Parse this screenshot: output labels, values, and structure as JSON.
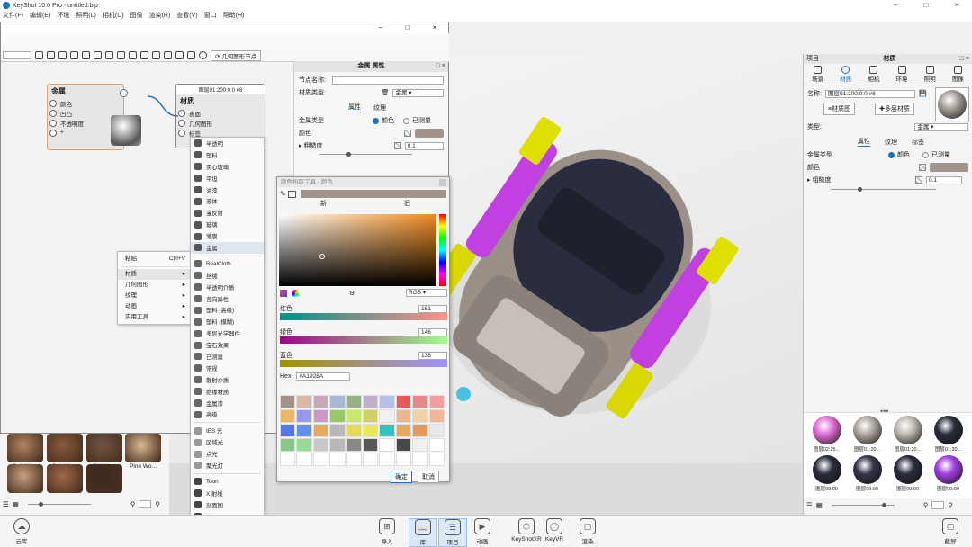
{
  "app": {
    "title": "KeyShot 10.0 Pro  -  untitled.bip"
  },
  "menu": [
    "文件(F)",
    "编辑(E)",
    "环境",
    "照明(L)",
    "相机(C)",
    "图像",
    "渲染(R)",
    "查看(V)",
    "窗口",
    "帮助(H)"
  ],
  "node_editor": {
    "geometry_node_button": "几何图形节点",
    "metal_node": {
      "title": "金属",
      "ports": [
        "颜色",
        "凹凸",
        "不透明度",
        "+"
      ]
    },
    "material_node": {
      "header": "图层01:200:0:0 #8",
      "title": "材质",
      "ports": [
        "表面",
        "几何图形",
        "标签"
      ]
    }
  },
  "properties": {
    "title": "金属 属性",
    "node_name_label": "节点名称:",
    "material_type_label": "材质类型:",
    "material_type_value": "金属",
    "tabs": [
      "属性",
      "纹理"
    ],
    "metal_type_label": "金属类型",
    "radio_color": "颜色",
    "radio_measured": "已测量",
    "color_label": "颜色",
    "roughness_label": "粗糙度",
    "roughness_value": "0.1"
  },
  "context_menu": {
    "items": [
      {
        "label": "粘贴",
        "shortcut": "Ctrl+V"
      },
      {
        "label": "材质",
        "arrow": "▸"
      },
      {
        "label": "几何图形",
        "arrow": "▸"
      },
      {
        "label": "纹理",
        "arrow": "▸"
      },
      {
        "label": "动画",
        "arrow": "▸"
      },
      {
        "label": "实用工具",
        "arrow": "▸"
      }
    ]
  },
  "submenu": {
    "group1": [
      "半透明",
      "塑料",
      "实心玻璃",
      "平坦",
      "油漆",
      "液体",
      "漫反射",
      "玻璃",
      "薄膜",
      "金属"
    ],
    "group2": [
      "RealCloth",
      "丝绒",
      "半透明介质",
      "各向异性",
      "塑料 (高级)",
      "塑料 (模糊)",
      "多层光学器件",
      "宝石效果",
      "已测量",
      "常规",
      "散射介质",
      "绝缘材质",
      "金属漆",
      "高级"
    ],
    "group3": [
      "IES 光",
      "区域光",
      "点光",
      "聚光灯"
    ],
    "group4": [
      "Toon",
      "X 射线",
      "剖面图",
      "地面",
      "线框",
      "自发光"
    ]
  },
  "color_picker": {
    "title": "颜色拾取工具 - 颜色",
    "new_label": "新",
    "old_label": "旧",
    "mode": "RGB",
    "red_label": "红色",
    "red_value": "161",
    "green_label": "绿色",
    "green_value": "146",
    "blue_label": "蓝色",
    "blue_value": "138",
    "hex_label": "Hex:",
    "hex_value": "#A1928A",
    "ok": "确定",
    "cancel": "取消",
    "current_color": "#a1928a",
    "palette": [
      "#a1928a",
      "#d8b8a8",
      "#c8a8b8",
      "#a8b8d8",
      "#98b088",
      "#c0b0d0",
      "#b8c0e8",
      "#e85858",
      "#e88888",
      "#f0a0a0",
      "#e8b868",
      "#9898e8",
      "#c898c8",
      "#98c868",
      "#c8e868",
      "#d0d068",
      "#f0f0f0",
      "#e8b890",
      "#f0d0a8",
      "#f0b898",
      "#5878e8",
      "#6090e8",
      "#e8a858",
      "#b8b8b8",
      "#e8d858",
      "#e8e858",
      "#38c0c0",
      "#e8a858",
      "#e89858",
      "#e8e8e8",
      "#88c888",
      "#98d898",
      "#c8c8c8",
      "#b8b8b8",
      "#888888",
      "#585858",
      "#ffffff",
      "#484848",
      "#f0f0f0",
      "#ffffff",
      "#ffffff",
      "#ffffff",
      "#ffffff",
      "#ffffff",
      "#ffffff",
      "#ffffff",
      "#ffffff",
      "#ffffff",
      "#ffffff",
      "#ffffff"
    ]
  },
  "library": {
    "items": [
      {
        "label": "Oak Wo...",
        "color": "#b08660"
      },
      {
        "label": "Oak Wo...",
        "color": "#8a5a3a"
      },
      {
        "label": "Old Wo...",
        "color": "#6e5440"
      },
      {
        "label": "Pine Wo...",
        "color": "#d8b890"
      },
      {
        "label": "",
        "color": "#c8a080"
      },
      {
        "label": "",
        "color": "#a06848"
      },
      {
        "label": "",
        "color": "#3a2820"
      }
    ]
  },
  "right_panel": {
    "left_title": "项目",
    "center_title": "材质",
    "tabs": [
      "场景",
      "材质",
      "相机",
      "环境",
      "照明",
      "图像"
    ],
    "name_label": "名称:",
    "name_value": "图层01:200:0:0 #8",
    "material_graph_btn": "材质图",
    "multilayer_btn": "多层材质",
    "type_label": "类型:",
    "type_value": "金属",
    "subtabs": [
      "属性",
      "纹理",
      "标签"
    ],
    "metal_type_label": "金属类型",
    "radio_color": "颜色",
    "radio_measured": "已测量",
    "color_label": "颜色",
    "roughness_label": "粗糙度",
    "roughness_value": "0.1",
    "thumbnails": [
      {
        "label": "图层02:25...",
        "color": "#e070d8"
      },
      {
        "label": "图层01:20...",
        "color": "#b0a8a0"
      },
      {
        "label": "图层01:20...",
        "color": "#c0b8b0"
      },
      {
        "label": "图层01:20...",
        "color": "#2a2c3c"
      },
      {
        "label": "图层00:00",
        "color": "#2a2c3c"
      },
      {
        "label": "图层00:00",
        "color": "#34364a"
      },
      {
        "label": "图层00:00",
        "color": "#2a2c3c"
      },
      {
        "label": "图层00:00",
        "color": "#a040e0"
      }
    ]
  },
  "bottom_bar": {
    "items": [
      "导入",
      "库",
      "项目",
      "动画",
      "KeyShotXR",
      "KeyVR",
      "渲染"
    ],
    "cloud": "云库",
    "screenshot": "截屏"
  }
}
